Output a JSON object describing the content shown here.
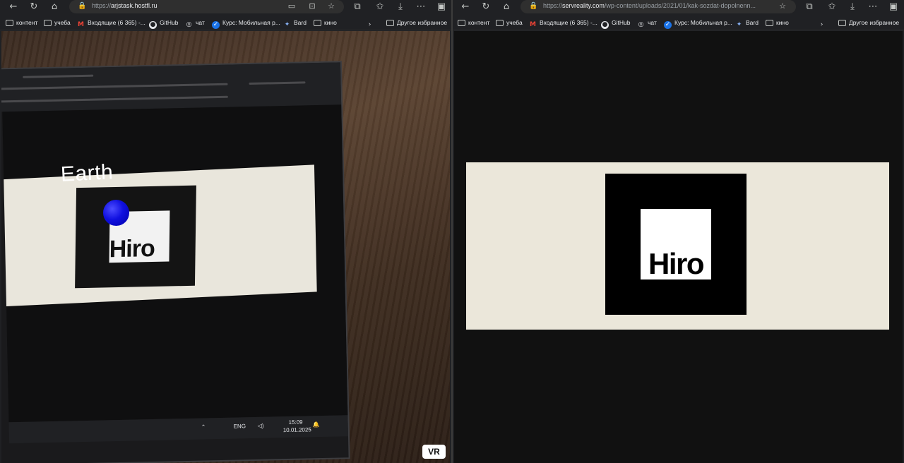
{
  "left": {
    "url_host": "arjstask.hostfl.ru",
    "url_scheme": "https://",
    "bookmarks": [
      {
        "label": "контент",
        "icon": "folder-icon"
      },
      {
        "label": "учеба",
        "icon": "folder-icon"
      },
      {
        "label": "Входящие (6 365) -...",
        "icon": "gmail-icon"
      },
      {
        "label": "GitHub",
        "icon": "github-icon"
      },
      {
        "label": "чат",
        "icon": "chatgpt-icon"
      },
      {
        "label": "Курс: Мобильная р...",
        "icon": "course-icon"
      },
      {
        "label": "Bard",
        "icon": "bard-icon"
      },
      {
        "label": "кино",
        "icon": "folder-icon"
      }
    ],
    "other_bookmarks": "Другое избранное",
    "camera": {
      "ar_label": "Earth",
      "marker_text": "Hiro",
      "sphere_color": "#1a1aff",
      "taskbar": {
        "lang": "ENG",
        "time": "15:09",
        "date": "10.01.2025"
      }
    },
    "vr_label": "VR"
  },
  "right": {
    "url_scheme": "https://",
    "url_host": "servreality.com",
    "url_path": "/wp-content/uploads/2021/01/kak-sozdat-dopolnenn...",
    "bookmarks": [
      {
        "label": "контент",
        "icon": "folder-icon"
      },
      {
        "label": "учеба",
        "icon": "folder-icon"
      },
      {
        "label": "Входящие (6 365) -...",
        "icon": "gmail-icon"
      },
      {
        "label": "GitHub",
        "icon": "github-icon"
      },
      {
        "label": "чат",
        "icon": "chatgpt-icon"
      },
      {
        "label": "Курс: Мобильная р...",
        "icon": "course-icon"
      },
      {
        "label": "Bard",
        "icon": "bard-icon"
      },
      {
        "label": "кино",
        "icon": "folder-icon"
      }
    ],
    "other_bookmarks": "Другое избранное",
    "marker_text": "Hiro"
  }
}
